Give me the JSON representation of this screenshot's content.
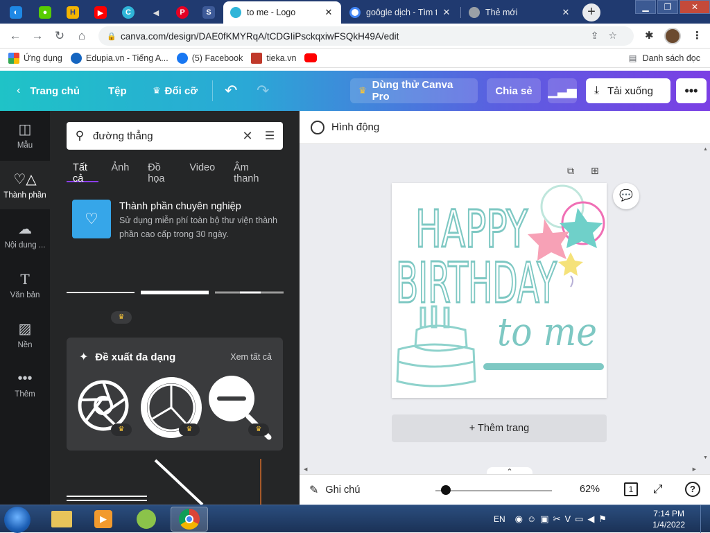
{
  "browser": {
    "tabs": [
      {
        "title": "to me - Logo",
        "active": true
      },
      {
        "title": "goôgle dịch - Tìm tr",
        "active": false
      },
      {
        "title": "Thẻ mới",
        "active": false
      }
    ],
    "url": "canva.com/design/DAE0fKMYRqA/tCDGIiPsckqxiwFSQkH49A/edit",
    "bookmarks": [
      "Ứng dụng",
      "Edupia.vn - Tiếng A...",
      "(5) Facebook",
      "tieka.vn"
    ],
    "reading_list": "Danh sách đọc"
  },
  "topbar": {
    "home": "Trang chủ",
    "file": "Tệp",
    "resize": "Đổi cỡ",
    "try_pro": "Dùng thử Canva Pro",
    "share": "Chia sẻ",
    "download": "Tải xuống"
  },
  "rail": [
    "Mẫu",
    "Thành phần",
    "Nội dung ...",
    "Văn bản",
    "Nền",
    "Thêm"
  ],
  "panel": {
    "search_value": "đường thẳng",
    "tabs": [
      "Tất cả",
      "Ảnh",
      "Đồ họa",
      "Video",
      "Âm thanh"
    ],
    "pro_title": "Thành phần chuyên nghiệp",
    "pro_desc_1": "Sử dụng miễn phí toàn bộ thư viện thành",
    "pro_desc_2": "phần cao cấp trong 30 ngày.",
    "suggest_title": "Đề xuất đa dạng",
    "see_all": "Xem tất cả"
  },
  "editor": {
    "animate": "Hình động",
    "design_line1": "HAPPY",
    "design_line2": "BIRTHDAY",
    "design_line3": "to me",
    "add_page": "+ Thêm trang",
    "notes": "Ghi chú",
    "zoom": "62%",
    "page_count": "1",
    "zoom_fraction": 0.09
  },
  "taskbar": {
    "lang": "EN",
    "time": "7:14 PM",
    "date": "1/4/2022"
  },
  "colors": {
    "teal": "#7cc7c2",
    "panel": "#252627",
    "rail": "#18191b",
    "accent": "#8b3dff"
  }
}
